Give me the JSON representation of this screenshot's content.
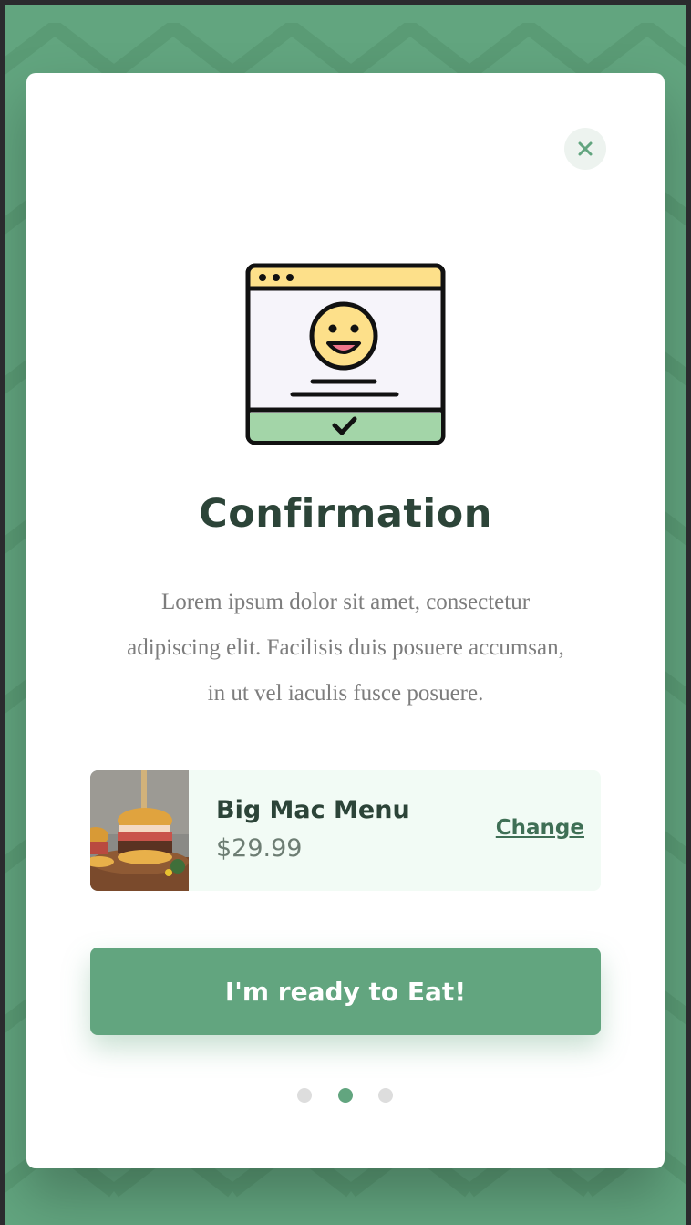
{
  "colors": {
    "background": "#62a57f",
    "accent": "#62a57f",
    "title": "#2c4438",
    "card_background": "#f2fbf5",
    "dot_inactive": "#dddddd"
  },
  "modal": {
    "close_icon": "close-icon",
    "illustration_icon": "browser-window-smiley-check-icon",
    "title": "Confirmation",
    "description": "Lorem ipsum dolor sit amet, consectetur adipiscing elit. Facilisis duis posuere accumsan, in ut vel iaculis fusce posuere.",
    "item": {
      "name": "Big Mac Menu",
      "price": "$29.99",
      "change_label": "Change",
      "image": "burger-photo"
    },
    "cta_label": "I'm ready to Eat!",
    "pagination": {
      "total": 3,
      "active_index": 1
    }
  }
}
